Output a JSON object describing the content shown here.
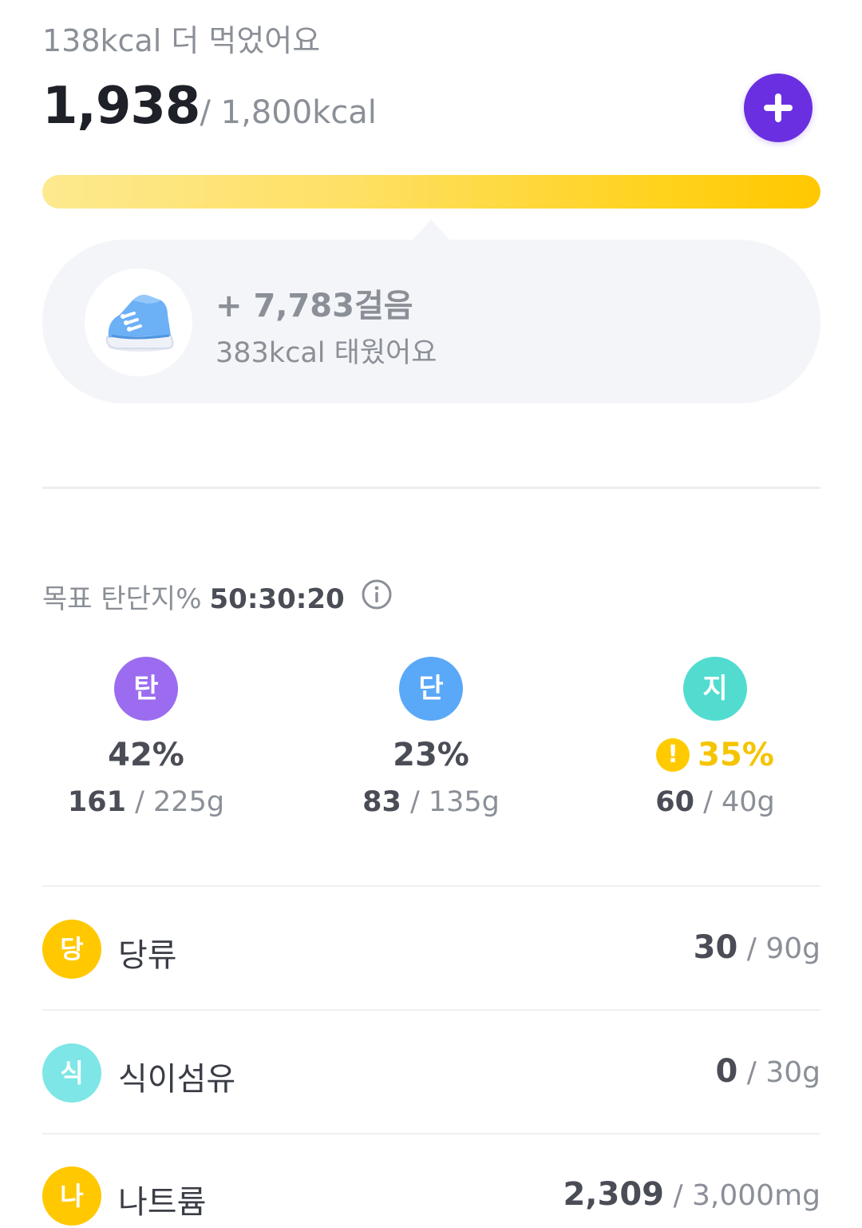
{
  "summary": {
    "over_text": "138kcal 더 먹었어요",
    "current_kcal": "1,938",
    "goal_kcal": "/ 1,800kcal",
    "progress_fraction": 1.0,
    "add_icon": "plus-icon"
  },
  "steps": {
    "icon": "sneaker-icon",
    "value": "+ 7,783걸음",
    "burned": "383kcal 태웠어요"
  },
  "macros": {
    "label": "목표 탄단지%",
    "ratio": "50:30:20",
    "info_icon": "info-icon",
    "items": [
      {
        "badge": "탄",
        "percent": "42%",
        "current": "161",
        "goal": " / 225g",
        "color": "#9b6cf0",
        "warning": false
      },
      {
        "badge": "단",
        "percent": "23%",
        "current": "83",
        "goal": " / 135g",
        "color": "#5aa8f8",
        "warning": false
      },
      {
        "badge": "지",
        "percent": "35%",
        "current": "60",
        "goal": " / 40g",
        "color": "#52dcd0",
        "warning": true,
        "warning_mark": "!"
      }
    ]
  },
  "nutrients": [
    {
      "badge": "당",
      "label": "당류",
      "current": "30",
      "goal": " / 90g",
      "color": "#ffc800"
    },
    {
      "badge": "식",
      "label": "식이섬유",
      "current": "0",
      "goal": " / 30g",
      "color": "#7ee6e6"
    },
    {
      "badge": "나",
      "label": "나트륨",
      "current": "2,309",
      "goal": " / 3,000mg",
      "color": "#ffc800"
    }
  ],
  "colors": {
    "accent": "#6a2fe0",
    "progress": "#ffc800",
    "warning": "#f5c400"
  }
}
